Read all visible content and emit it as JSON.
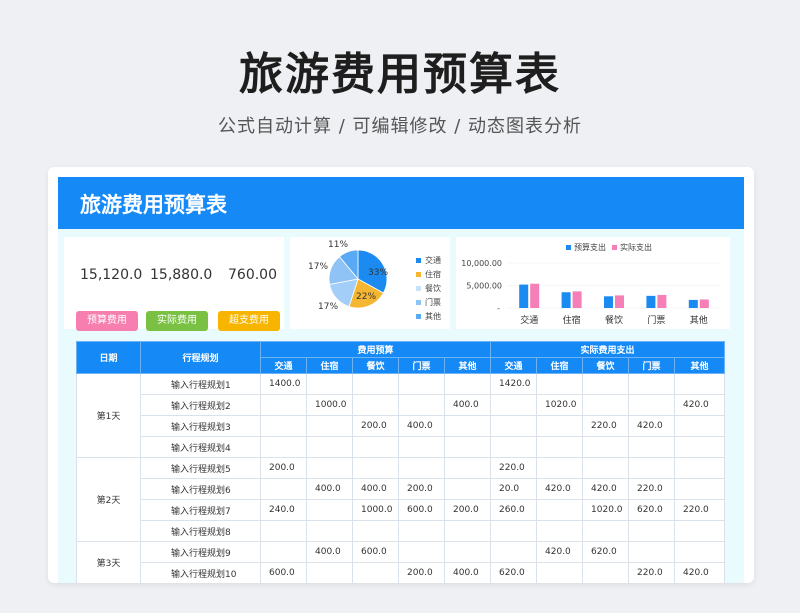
{
  "hero": {
    "title": "旅游费用预算表",
    "subtitle": "公式自动计算 / 可编辑修改 / 动态图表分析"
  },
  "banner": {
    "title": "旅游费用预算表"
  },
  "kpis": [
    {
      "value": "15,120.0",
      "label": "预算费用",
      "color": "#f77fb0"
    },
    {
      "value": "15,880.0",
      "label": "实际费用",
      "color": "#7ac143"
    },
    {
      "value": "760.00",
      "label": "超支费用",
      "color": "#f7b500"
    }
  ],
  "pie": {
    "slices": [
      {
        "label": "33%",
        "value": 33,
        "color": "#1b8bf2"
      },
      {
        "label": "22%",
        "value": 22,
        "color": "#f5b731"
      },
      {
        "label": "17%",
        "value": 17,
        "color": "#a3cef7"
      },
      {
        "label": "17%",
        "value": 17,
        "color": "#8fc3f5"
      },
      {
        "label": "11%",
        "value": 11,
        "color": "#5aa9f4"
      }
    ],
    "legend": [
      {
        "label": "交通",
        "color": "#1b8bf2"
      },
      {
        "label": "住宿",
        "color": "#f5b731"
      },
      {
        "label": "餐饮",
        "color": "#c7e3fb"
      },
      {
        "label": "门票",
        "color": "#8fc3f5"
      },
      {
        "label": "其他",
        "color": "#5aa9f4"
      }
    ]
  },
  "chart_data": {
    "type": "bar",
    "categories": [
      "交通",
      "住宿",
      "餐饮",
      "门票",
      "其他"
    ],
    "series": [
      {
        "name": "预算支出",
        "color": "#1b8bf2",
        "values": [
          5200,
          3500,
          2600,
          2700,
          1800
        ]
      },
      {
        "name": "实际支出",
        "color": "#f57fb6",
        "values": [
          5400,
          3700,
          2800,
          2900,
          1900
        ]
      }
    ],
    "yticks": [
      "10,000.00",
      "5,000.00",
      "-"
    ],
    "ylim": [
      0,
      10000
    ]
  },
  "table": {
    "h_date": "日期",
    "h_plan": "行程规划",
    "h_budget": "费用预算",
    "h_actual": "实际费用支出",
    "sub": [
      "交通",
      "住宿",
      "餐饮",
      "门票",
      "其他"
    ],
    "groups": [
      {
        "date": "第1天",
        "rows": [
          {
            "plan": "输入行程规划1",
            "b": [
              "1400.0",
              "",
              "",
              "",
              ""
            ],
            "a": [
              "1420.0",
              "",
              "",
              "",
              ""
            ]
          },
          {
            "plan": "输入行程规划2",
            "b": [
              "",
              "1000.0",
              "",
              "",
              "400.0"
            ],
            "a": [
              "",
              "1020.0",
              "",
              "",
              "420.0"
            ]
          },
          {
            "plan": "输入行程规划3",
            "b": [
              "",
              "",
              "200.0",
              "400.0",
              ""
            ],
            "a": [
              "",
              "",
              "220.0",
              "420.0",
              ""
            ]
          },
          {
            "plan": "输入行程规划4",
            "b": [
              "",
              "",
              "",
              "",
              ""
            ],
            "a": [
              "",
              "",
              "",
              "",
              ""
            ]
          }
        ]
      },
      {
        "date": "第2天",
        "rows": [
          {
            "plan": "输入行程规划5",
            "b": [
              "200.0",
              "",
              "",
              "",
              ""
            ],
            "a": [
              "220.0",
              "",
              "",
              "",
              ""
            ]
          },
          {
            "plan": "输入行程规划6",
            "b": [
              "",
              "400.0",
              "400.0",
              "200.0",
              ""
            ],
            "a": [
              "20.0",
              "420.0",
              "420.0",
              "220.0",
              ""
            ]
          },
          {
            "plan": "输入行程规划7",
            "b": [
              "240.0",
              "",
              "1000.0",
              "600.0",
              "200.0"
            ],
            "a": [
              "260.0",
              "",
              "1020.0",
              "620.0",
              "220.0"
            ]
          },
          {
            "plan": "输入行程规划8",
            "b": [
              "",
              "",
              "",
              "",
              ""
            ],
            "a": [
              "",
              "",
              "",
              "",
              ""
            ]
          }
        ]
      },
      {
        "date": "第3天",
        "rows": [
          {
            "plan": "输入行程规划9",
            "b": [
              "",
              "400.0",
              "600.0",
              "",
              ""
            ],
            "a": [
              "",
              "420.0",
              "620.0",
              "",
              ""
            ]
          },
          {
            "plan": "输入行程规划10",
            "b": [
              "600.0",
              "",
              "",
              "200.0",
              "400.0"
            ],
            "a": [
              "620.0",
              "",
              "",
              "220.0",
              "420.0"
            ]
          }
        ]
      }
    ]
  }
}
